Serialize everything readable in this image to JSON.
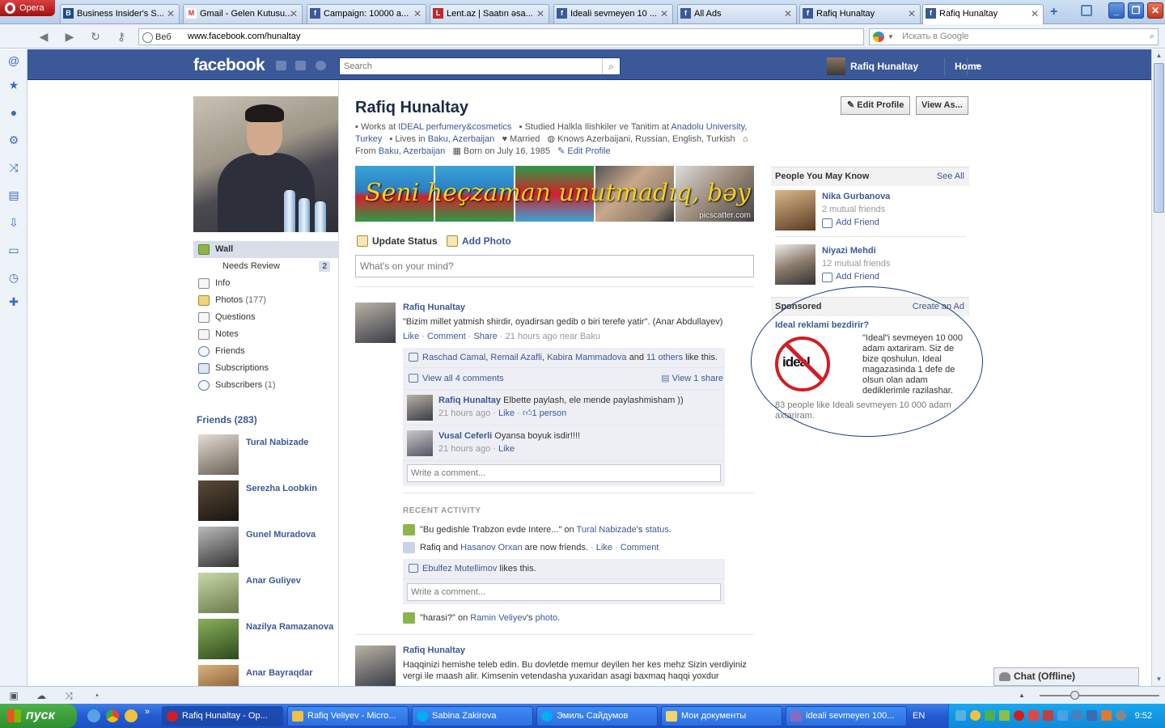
{
  "browser": {
    "menu_label": "Opera",
    "tabs": [
      {
        "label": "Business Insider's S...",
        "fav": "B"
      },
      {
        "label": "Gmail - Gelen Kutusu...",
        "fav": "M"
      },
      {
        "label": "Campaign: 10000 a...",
        "fav": "f"
      },
      {
        "label": "Lent.az | Saatın əsa...",
        "fav": "L"
      },
      {
        "label": "Ideali sevmeyen 10 ...",
        "fav": "f"
      },
      {
        "label": "All Ads",
        "fav": "f"
      },
      {
        "label": "Rafiq Hunaltay",
        "fav": "f"
      },
      {
        "label": "Rafiq Hunaltay",
        "fav": "f"
      }
    ],
    "web_label": "Веб",
    "url": "www.facebook.com/hunaltay",
    "search_placeholder": "Искать в Google"
  },
  "fb_header": {
    "logo": "facebook",
    "search_placeholder": "Search",
    "user_name": "Rafiq Hunaltay",
    "home_label": "Home"
  },
  "profile": {
    "name": "Rafiq Hunaltay",
    "info": {
      "works_prefix": "Works at ",
      "works_link": "IDEAL perfumery&cosmetics",
      "studied_prefix": "Studied Halkla Ilishkiler ve Tanitim at ",
      "studied_link": "Anadolu University, Turkey",
      "lives_prefix": "Lives in ",
      "lives_link": "Baku, Azerbaijan",
      "relationship": "Married",
      "languages": "Knows Azerbaijani, Russian, English, Turkish",
      "from_prefix": "From ",
      "from_link": "Baku, Azerbaijan",
      "born": "Born on July 16, 1985",
      "edit_link": "Edit Profile"
    },
    "banner_text": "Seni heçzaman unutmadıq, bəy",
    "banner_watermark": "picscatter.com",
    "edit_profile_button": "Edit Profile",
    "view_as_button": "View As..."
  },
  "left_nav": [
    {
      "label": "Wall",
      "count": "",
      "badge": ""
    },
    {
      "label": "Needs Review",
      "count": "",
      "badge": "2"
    },
    {
      "label": "Info",
      "count": "",
      "badge": ""
    },
    {
      "label": "Photos",
      "count": "(177)",
      "badge": ""
    },
    {
      "label": "Questions",
      "count": "",
      "badge": ""
    },
    {
      "label": "Notes",
      "count": "",
      "badge": ""
    },
    {
      "label": "Friends",
      "count": "",
      "badge": ""
    },
    {
      "label": "Subscriptions",
      "count": "",
      "badge": ""
    },
    {
      "label": "Subscribers",
      "count": "(1)",
      "badge": ""
    }
  ],
  "friends": {
    "heading": "Friends (283)",
    "items": [
      {
        "name": "Tural Nabizade",
        "color": "#6b6055"
      },
      {
        "name": "Serezha Loobkin",
        "color": "#2d2620"
      },
      {
        "name": "Gunel Muradova",
        "color": "#7a7a7a"
      },
      {
        "name": "Anar Guliyev",
        "color": "#8aa36a"
      },
      {
        "name": "Nazilya Ramazanova",
        "color": "#5f8a3c"
      },
      {
        "name": "Anar Bayraqdar",
        "color": "#9c6a3a"
      }
    ]
  },
  "composer": {
    "update_status": "Update Status",
    "add_photo": "Add Photo",
    "placeholder": "What's on your mind?"
  },
  "posts": [
    {
      "author": "Rafiq Hunaltay",
      "text": "\"Bizim millet yatmish shirdir, oyadirsan gedib o biri terefe yatir\". (Anar Abdullayev)",
      "actions": {
        "like": "Like",
        "comment": "Comment",
        "share": "Share",
        "time": "21 hours ago near Baku"
      },
      "likes": {
        "names": [
          "Raschad Camal",
          "Remail Azafli",
          "Kabira Mammadova"
        ],
        "others": "11 others",
        "suffix": "like this.",
        "and": "and"
      },
      "view_comments": "View all 4 comments",
      "view_share": "View 1 share",
      "comments": [
        {
          "author": "Rafiq Hunaltay",
          "text": "Elbette paylash, ele mende paylashmisham ))",
          "time": "21 hours ago",
          "like": "Like",
          "likes": "1 person"
        },
        {
          "author": "Vusal Ceferli",
          "text": "Oyansa boyuk isdir!!!!",
          "time": "21 hours ago",
          "like": "Like",
          "likes": ""
        }
      ],
      "write_comment": "Write a comment..."
    }
  ],
  "recent_activity": {
    "heading": "RECENT ACTIVITY",
    "item1_quote": "\"Bu gedishle Trabzon evde Intere...\"",
    "item1_on": " on ",
    "item1_who": "Tural Nabizade",
    "item1_poss": "'s ",
    "item1_what": "status",
    "item2_a": "Rafiq and ",
    "item2_who": "Hasanov Orxan",
    "item2_b": " are now friends.",
    "item2_like": "Like",
    "item2_comment": "Comment",
    "likes_name": "Ebulfez Mutellimov",
    "likes_suffix": " likes this.",
    "write_comment": "Write a comment...",
    "item3_quote": "\"harasi?\"",
    "item3_on": " on ",
    "item3_who": "Ramin Veliyev",
    "item3_poss": "'s ",
    "item3_what": "photo"
  },
  "post2": {
    "author": "Rafiq Hunaltay",
    "text": "Haqqinizi hemishe teleb edin. Bu dovletde memur deyilen her kes mehz Sizin verdiyiniz vergi ile maash alir. Kimsenin vetendasha yuxaridan asagi baxmaq haqqi yoxdur"
  },
  "pymk": {
    "heading": "People You May Know",
    "see_all": "See All",
    "people": [
      {
        "name": "Nika Gurbanova",
        "mutual": "2 mutual friends",
        "add": "Add Friend",
        "color": "#8a5a3a"
      },
      {
        "name": "Niyazi Mehdi",
        "mutual": "12 mutual friends",
        "add": "Add Friend",
        "color": "#9a8a7a"
      }
    ]
  },
  "sponsored": {
    "heading": "Sponsored",
    "create_ad": "Create an Ad",
    "title": "Ideal reklami bezdirir?",
    "logo_text": "ideal",
    "body": "\"Ideal\"i sevmeyen 10 000 adam axtariram. Siz de bize qoshulun. Ideal magazasinda 1 defe de olsun olan adam dediklerimle razilashar.",
    "social": "83 people like Ideali sevmeyen 10 000 adam axtariram."
  },
  "chat": {
    "label": "Chat (Offline)"
  },
  "taskbar": {
    "start": "пуск",
    "tasks": [
      {
        "label": "Rafiq Hunaltay - Op...",
        "color": "#d21d23"
      },
      {
        "label": "Rafiq Veliyev - Micro...",
        "color": "#f0c040"
      },
      {
        "label": "Sabina Zakirova",
        "color": "#00aff0"
      },
      {
        "label": "Эмиль Сайдумов",
        "color": "#00aff0"
      },
      {
        "label": "Мои документы",
        "color": "#f3d66b"
      },
      {
        "label": "ideali sevmeyen 100...",
        "color": "#8a6ac0"
      }
    ],
    "lang": "EN",
    "clock": "9:52"
  }
}
